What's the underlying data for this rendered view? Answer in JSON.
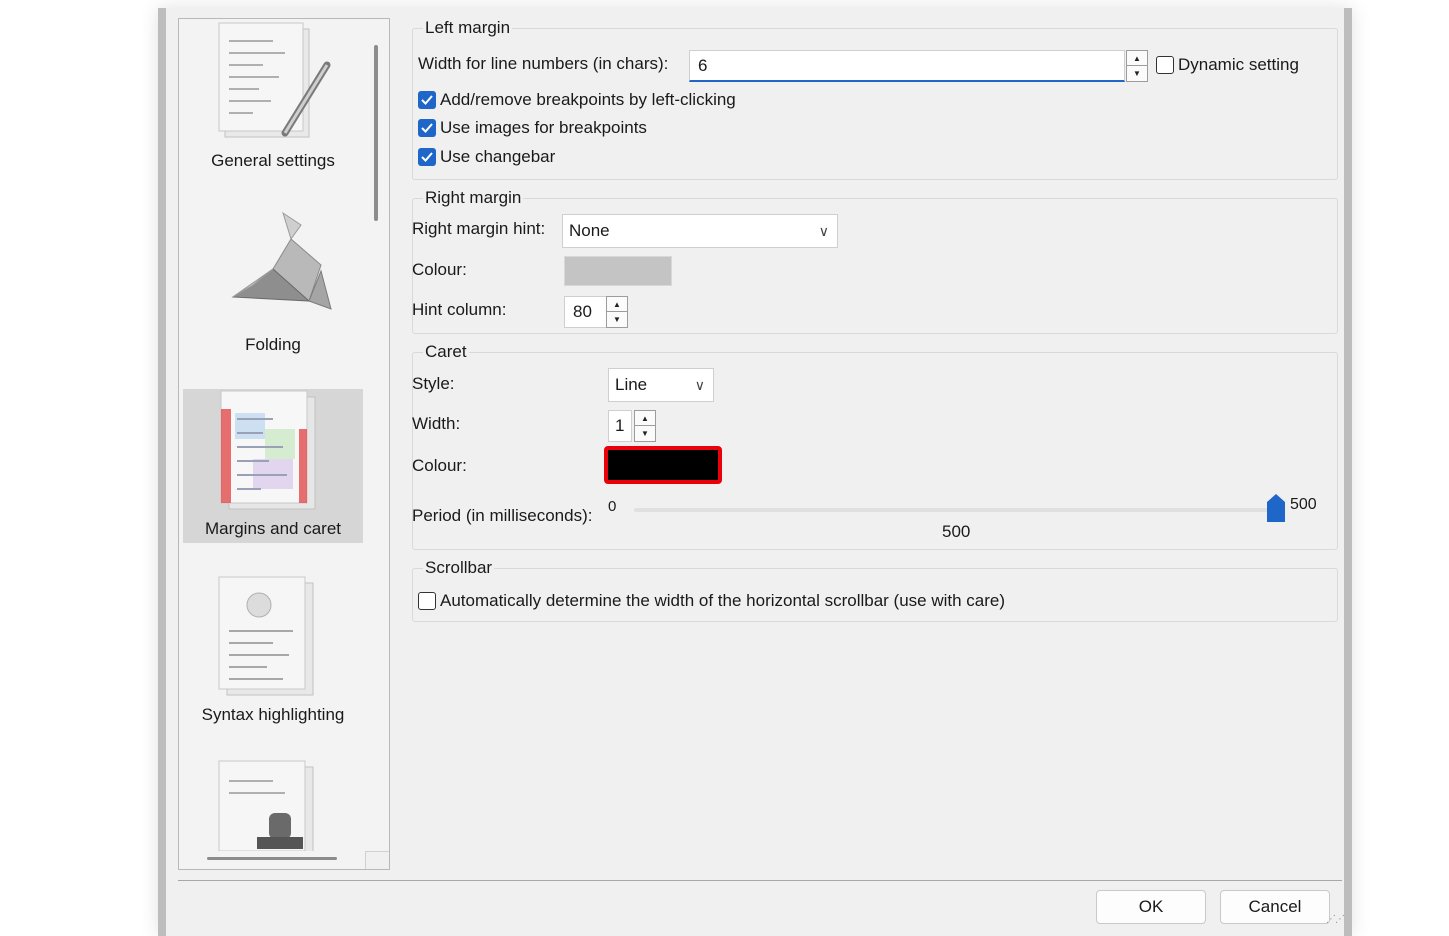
{
  "sidebar": {
    "items": [
      {
        "label": "General settings",
        "icon": "general-settings-icon",
        "selected": false
      },
      {
        "label": "Folding",
        "icon": "folding-icon",
        "selected": false
      },
      {
        "label": "Margins and caret",
        "icon": "margins-caret-icon",
        "selected": true
      },
      {
        "label": "Syntax highlighting",
        "icon": "syntax-highlighting-icon",
        "selected": false
      },
      {
        "label": "",
        "icon": "stamp-icon",
        "selected": false
      }
    ]
  },
  "left_margin": {
    "legend": "Left margin",
    "width_label": "Width for line numbers (in chars):",
    "width_value": "6",
    "dynamic_label": "Dynamic setting",
    "dynamic_checked": false,
    "add_remove_label": "Add/remove breakpoints by left-clicking",
    "add_remove_checked": true,
    "use_images_label": "Use images for breakpoints",
    "use_images_checked": true,
    "changebar_label": "Use changebar",
    "changebar_checked": true
  },
  "right_margin": {
    "legend": "Right margin",
    "hint_label": "Right margin hint:",
    "hint_value": "None",
    "colour_label": "Colour:",
    "colour_value": "#c4c4c4",
    "hint_column_label": "Hint column:",
    "hint_column_value": "80"
  },
  "caret": {
    "legend": "Caret",
    "style_label": "Style:",
    "style_value": "Line",
    "width_label": "Width:",
    "width_value": "1",
    "colour_label": "Colour:",
    "colour_value": "#000000",
    "colour_highlight": "#e8000b",
    "period_label": "Period (in milliseconds):",
    "period_min": "0",
    "period_max": "500",
    "period_value": "500",
    "period_fraction": 1.0
  },
  "scrollbar": {
    "legend": "Scrollbar",
    "auto_label": "Automatically determine the width of the horizontal scrollbar (use with care)",
    "auto_checked": false
  },
  "footer": {
    "ok_label": "OK",
    "cancel_label": "Cancel"
  },
  "colors": {
    "accent": "#1e66c8",
    "selection": "#d6d6d6"
  }
}
